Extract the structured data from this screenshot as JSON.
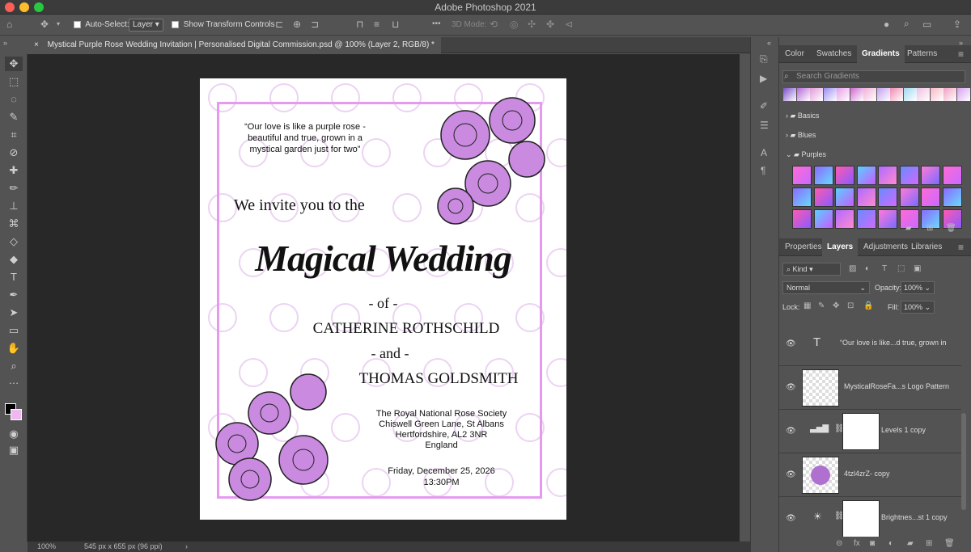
{
  "window": {
    "title": "Adobe Photoshop 2021"
  },
  "options": {
    "auto_select_label": "Auto-Select:",
    "auto_select_value": "Layer",
    "transform_controls_label": "Show Transform Controls",
    "mode_3d_label": "3D Mode:",
    "more_label": "•••"
  },
  "document": {
    "tab_title": "Mystical Purple Rose Wedding Invitation | Personalised Digital Commission.psd @ 100% (Layer 2, RGB/8) *",
    "zoom": "100%",
    "info": "545 px x 655 px (96 ppi)"
  },
  "invitation": {
    "quote": [
      "“Our love is like a purple rose -",
      "beautiful and true, grown in a",
      "mystical garden just for two”"
    ],
    "invite": "We invite you to the",
    "title": "Magical Wedding",
    "of": "- of -",
    "name1": "CATHERINE ROTHSCHILD",
    "and": "- and -",
    "name2": "THOMAS GOLDSMITH",
    "venue": [
      "The Royal National Rose Society",
      "Chiswell Green Lane, St Albans",
      "Hertfordshire, AL2 3NR",
      "England"
    ],
    "date": "Friday, December 25, 2026",
    "time": "13:30PM"
  },
  "panel_top": {
    "tabs": [
      "Color",
      "Swatches",
      "Gradients",
      "Patterns"
    ],
    "active_tab": "Gradients",
    "search_placeholder": "Search Gradients",
    "folders": [
      "Basics",
      "Blues",
      "Purples"
    ]
  },
  "panel_bottom": {
    "tabs": [
      "Properties",
      "Layers",
      "Adjustments",
      "Libraries"
    ],
    "active_tab": "Layers",
    "kind_label": "Kind",
    "blend_mode": "Normal",
    "opacity_label": "Opacity:",
    "opacity_value": "100%",
    "lock_label": "Lock:",
    "fill_label": "Fill:",
    "fill_value": "100%",
    "layers": [
      {
        "name": "“Our love is like...d true, grown in",
        "type": "text"
      },
      {
        "name": "MysticalRoseFa...s Logo Pattern",
        "type": "pattern"
      },
      {
        "name": "Levels 1 copy",
        "type": "adjustment"
      },
      {
        "name": "4tzl4zrZ- copy",
        "type": "image"
      },
      {
        "name": "Brightnes...st 1 copy",
        "type": "adjustment"
      }
    ]
  },
  "colors": {
    "accent_purple": "#e59af0",
    "rose_purple": "#b070d0",
    "background_swatch": "#f0b8f0"
  }
}
